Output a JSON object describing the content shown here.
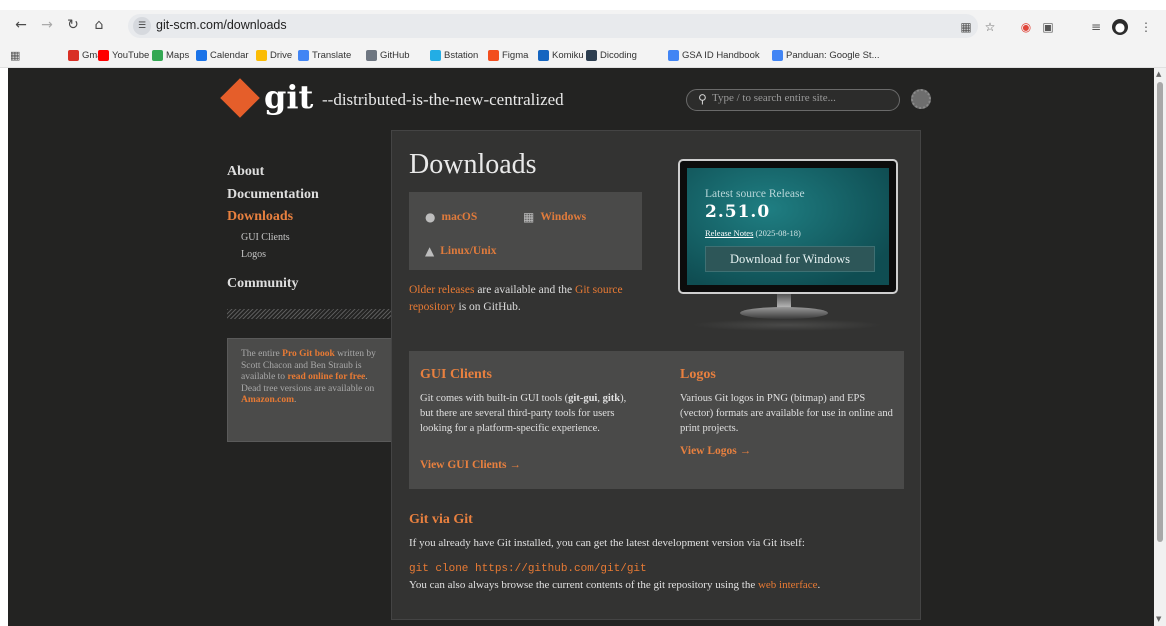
{
  "browser": {
    "url": "git-scm.com/downloads",
    "bookmarks": [
      {
        "label": "Gmail",
        "color": "#d93025"
      },
      {
        "label": "YouTube",
        "color": "#ff0000"
      },
      {
        "label": "Maps",
        "color": "#34a853"
      },
      {
        "label": "Calendar",
        "color": "#1a73e8"
      },
      {
        "label": "Drive",
        "color": "#fbbc04"
      },
      {
        "label": "Translate",
        "color": "#4285f4"
      },
      {
        "label": "GitHub",
        "color": "#6e7681"
      },
      {
        "label": "Bstation",
        "color": "#23ade5"
      },
      {
        "label": "Figma",
        "color": "#f24e1e"
      },
      {
        "label": "Komiku",
        "color": "#1565c0"
      },
      {
        "label": "Dicoding",
        "color": "#2d3e50"
      },
      {
        "label": "GSA ID Handbook",
        "color": "#4285f4"
      },
      {
        "label": "Panduan: Google St...",
        "color": "#4285f4"
      }
    ]
  },
  "header": {
    "logo_text": "git",
    "tagline": "--distributed-is-the-new-centralized",
    "search_placeholder": "Type / to search entire site..."
  },
  "sidebar": {
    "items": [
      {
        "label": "About",
        "active": false
      },
      {
        "label": "Documentation",
        "active": false
      },
      {
        "label": "Downloads",
        "active": true
      },
      {
        "label": "Community",
        "active": false
      }
    ],
    "sub_items": [
      "GUI Clients",
      "Logos"
    ],
    "book": {
      "p1": "The entire ",
      "link1": "Pro Git book",
      "p2": " written by Scott Chacon and Ben Straub is available to ",
      "link2": "read online for free",
      "p3": ". Dead tree versions are available on ",
      "link3": "Amazon.com",
      "p4": "."
    }
  },
  "main": {
    "title": "Downloads",
    "os_links": [
      {
        "label": "macOS",
        "icon": "apple-icon"
      },
      {
        "label": "Windows",
        "icon": "windows-icon"
      },
      {
        "label": "Linux/Unix",
        "icon": "linux-icon"
      }
    ],
    "older": {
      "link1": "Older releases",
      "text1": " are available and the ",
      "link2": "Git source repository",
      "text2": " is on GitHub."
    },
    "release": {
      "label": "Latest source Release",
      "version": "2.51.0",
      "notes_link": "Release Notes",
      "notes_date": "(2025-08-18)",
      "button": "Download for Windows"
    },
    "gui": {
      "title": "GUI Clients",
      "b1": "Git comes with built-in GUI tools (",
      "s1": "git-gui",
      "b2": ", ",
      "s2": "gitk",
      "b3": "), but there are several third-party tools for users looking for a platform-specific experience.",
      "link": "View GUI Clients →"
    },
    "logos": {
      "title": "Logos",
      "body": "Various Git logos in PNG (bitmap) and EPS (vector) formats are available for use in online and print projects.",
      "link": "View Logos →"
    },
    "gvg": {
      "title": "Git via Git",
      "p1": "If you already have Git installed, you can get the latest development version via Git itself:",
      "code": "git clone https://github.com/git/git",
      "p2": "You can also always browse the current contents of the git repository using the ",
      "p2_link": "web interface",
      "p2_end": "."
    }
  }
}
